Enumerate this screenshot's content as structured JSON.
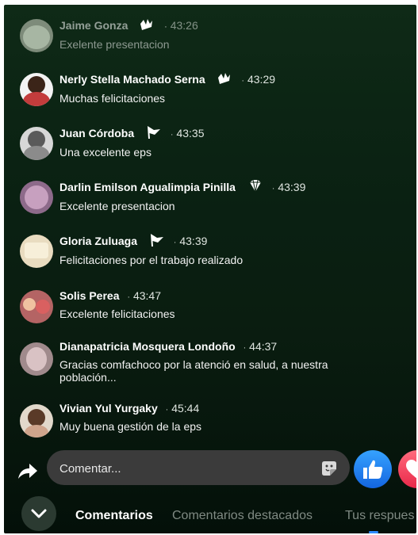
{
  "comments": [
    {
      "name": "Jaime Gonza",
      "badge": "clapping-hands-icon",
      "time": "43:26",
      "text": "Exelente presentacion"
    },
    {
      "name": "Nerly Stella Machado Serna",
      "badge": "clapping-hands-icon",
      "time": "43:29",
      "text": "Muchas felicitaciones"
    },
    {
      "name": "Juan Córdoba",
      "badge": "flag-icon",
      "time": "43:35",
      "text": "Una excelente eps"
    },
    {
      "name": "Darlin Emilson Agualimpia Pinilla",
      "badge": "diamond-icon",
      "time": "43:39",
      "text": "Excelente presentacion"
    },
    {
      "name": "Gloria Zuluaga",
      "badge": "flag-icon",
      "time": "43:39",
      "text": "Felicitaciones  por el trabajo  realizado"
    },
    {
      "name": "Solis Perea",
      "badge": "",
      "time": "43:47",
      "text": "Excelente felicitaciones"
    },
    {
      "name": "Dianapatricia Mosquera Londoño",
      "badge": "",
      "time": "44:37",
      "text": "Gracias comfachoco por la atenció en salud, a nuestra población..."
    },
    {
      "name": "Vivian Yul Yurgaky",
      "badge": "",
      "time": "45:44",
      "text": "Muy buena gestión de la eps"
    }
  ],
  "separator": "·",
  "input": {
    "placeholder": "Comentar..."
  },
  "tabs": [
    "Comentarios",
    "Comentarios destacados",
    "Tus respues"
  ],
  "colors": {
    "like": "#1877f2",
    "love": "#f33e58",
    "tab_active": "#ffffff",
    "tab_inactive": "#7f8a83"
  },
  "icons": {
    "share": "share-arrow-icon",
    "sticker": "sticker-icon",
    "like": "thumbs-up-icon",
    "love": "heart-icon",
    "collapse": "chevron-down-icon"
  }
}
